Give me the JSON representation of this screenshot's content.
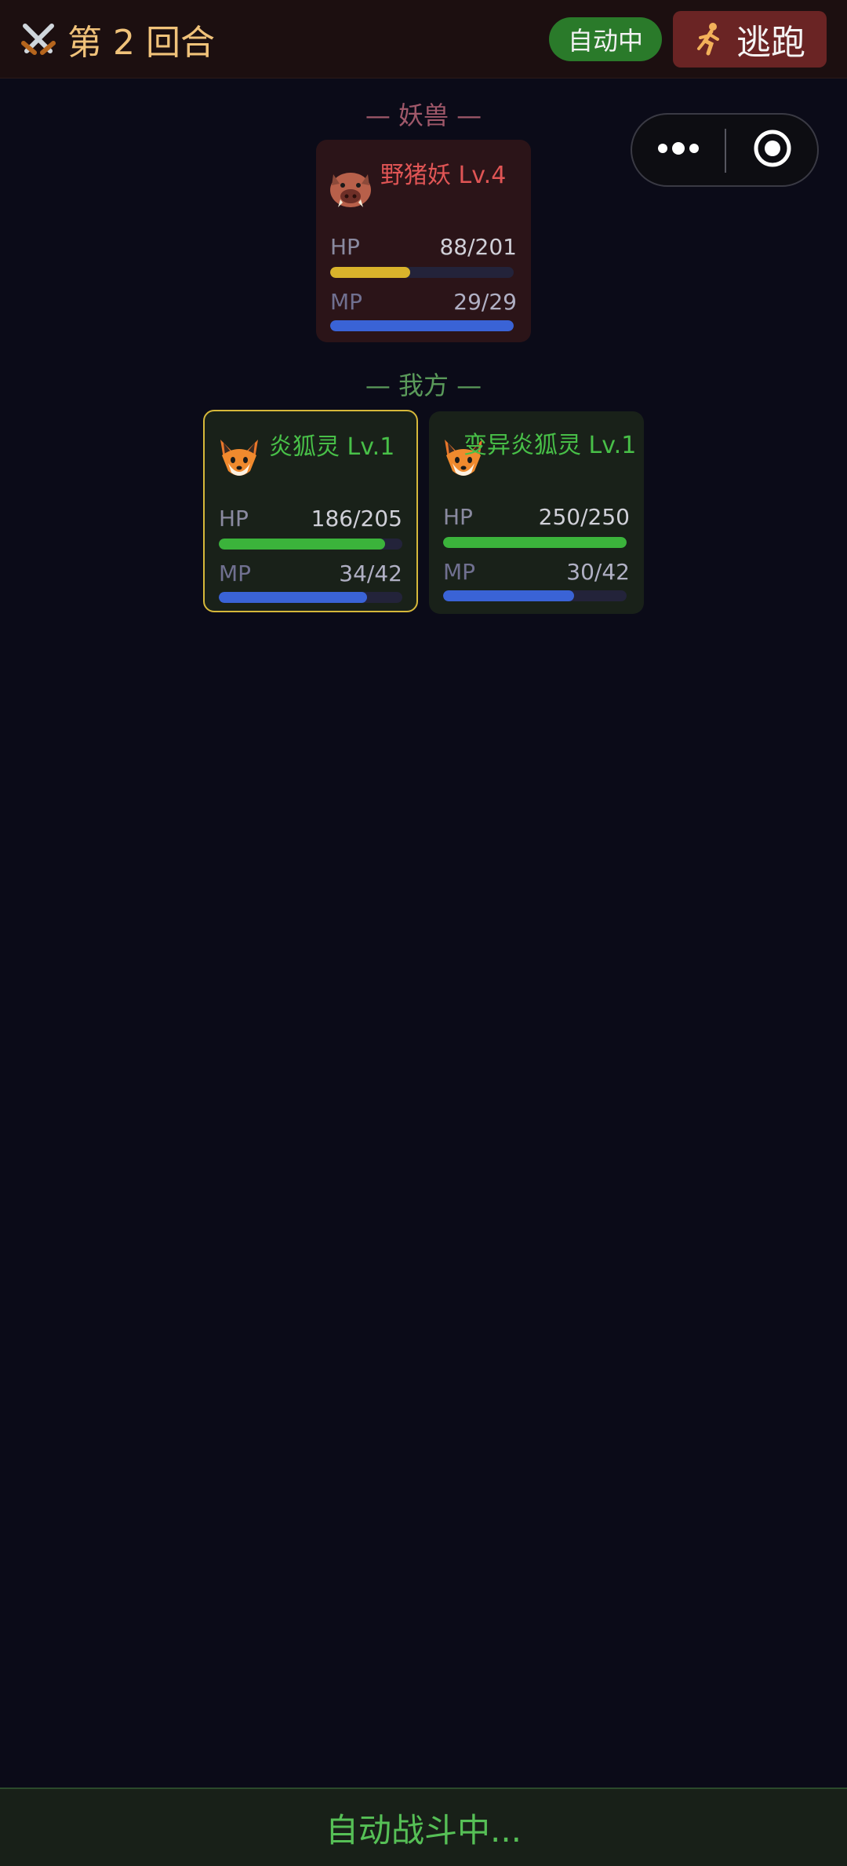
{
  "header": {
    "round_label": "第 2 回合",
    "auto_badge": "自动中",
    "escape_label": "逃跑"
  },
  "sections": {
    "enemy_label": "— 妖兽 —",
    "ally_label": "— 我方 —"
  },
  "enemies": [
    {
      "name": "野猪妖 Lv.4",
      "avatar_icon": "boar-icon",
      "hp": {
        "label": "HP",
        "text": "88/201",
        "current": 88,
        "max": 201,
        "color": "#d9b32b"
      },
      "mp": {
        "label": "MP",
        "text": "29/29",
        "current": 29,
        "max": 29,
        "color": "#3a63d6"
      }
    }
  ],
  "allies": [
    {
      "name": "炎狐灵 Lv.1",
      "avatar_icon": "fox-icon",
      "active": true,
      "hp": {
        "label": "HP",
        "text": "186/205",
        "current": 186,
        "max": 205,
        "color": "#3bb33b"
      },
      "mp": {
        "label": "MP",
        "text": "34/42",
        "current": 34,
        "max": 42,
        "color": "#3a63d6"
      }
    },
    {
      "name": "变异炎狐灵 Lv.1",
      "avatar_icon": "fox-icon",
      "active": false,
      "hp": {
        "label": "HP",
        "text": "250/250",
        "current": 250,
        "max": 250,
        "color": "#3bb33b"
      },
      "mp": {
        "label": "MP",
        "text": "30/42",
        "current": 30,
        "max": 42,
        "color": "#3a63d6"
      }
    }
  ],
  "footer": {
    "status": "自动战斗中..."
  }
}
